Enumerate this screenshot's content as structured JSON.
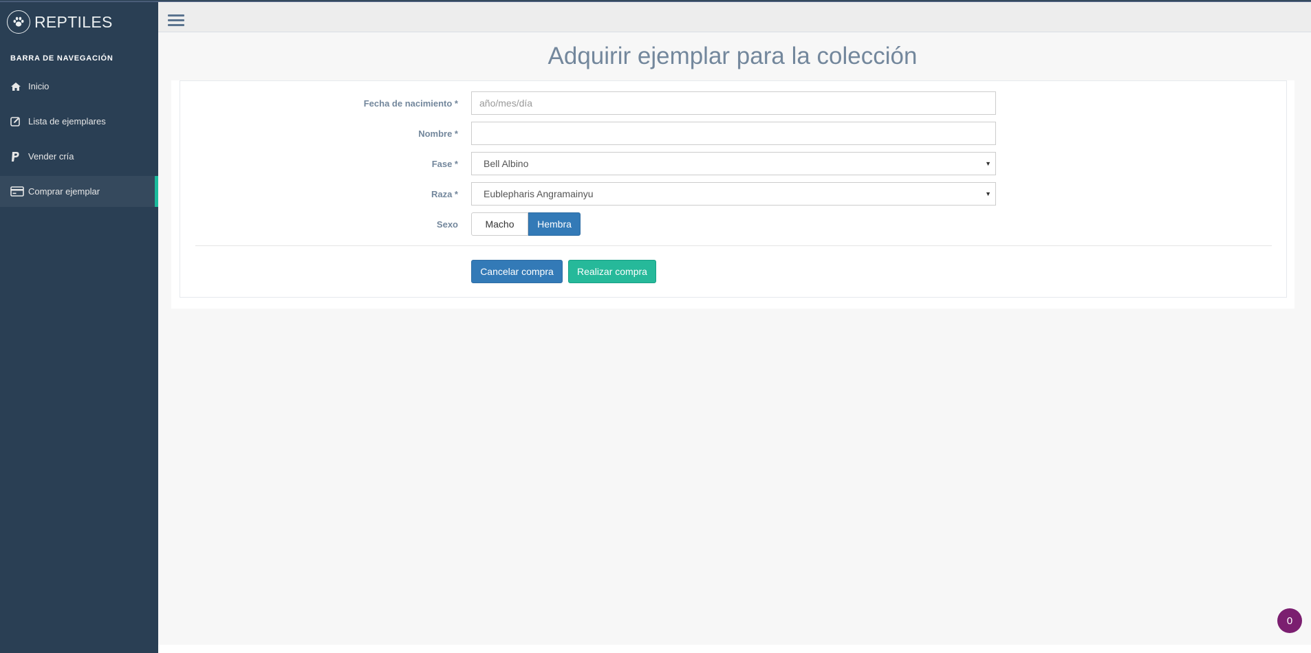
{
  "brand": {
    "title": "REPTILES",
    "icon": "paw-icon"
  },
  "sidebar": {
    "section_title": "BARRA DE NAVEGACIÓN",
    "items": [
      {
        "label": "Inicio",
        "icon": "home-icon"
      },
      {
        "label": "Lista de ejemplares",
        "icon": "edit-icon"
      },
      {
        "label": "Vender cría",
        "icon": "paypal-icon"
      },
      {
        "label": "Comprar ejemplar",
        "icon": "credit-card-icon",
        "active": true
      }
    ]
  },
  "page": {
    "title": "Adquirir ejemplar para la colección"
  },
  "form": {
    "birthdate": {
      "label": "Fecha de nacimiento *",
      "placeholder": "año/mes/día",
      "value": ""
    },
    "name": {
      "label": "Nombre *",
      "value": ""
    },
    "phase": {
      "label": "Fase *",
      "selected": "Bell Albino"
    },
    "breed": {
      "label": "Raza *",
      "selected": "Eublepharis Angramainyu"
    },
    "sex": {
      "label": "Sexo",
      "options": [
        "Macho",
        "Hembra"
      ],
      "selected": "Hembra"
    }
  },
  "actions": {
    "cancel_label": "Cancelar compra",
    "submit_label": "Realizar compra"
  },
  "notification": {
    "count": "0"
  },
  "colors": {
    "sidebar": "#2a3f54",
    "accent": "#1abb9c",
    "primary": "#337ab7",
    "success": "#26b99a",
    "badge": "#7b1f70"
  }
}
